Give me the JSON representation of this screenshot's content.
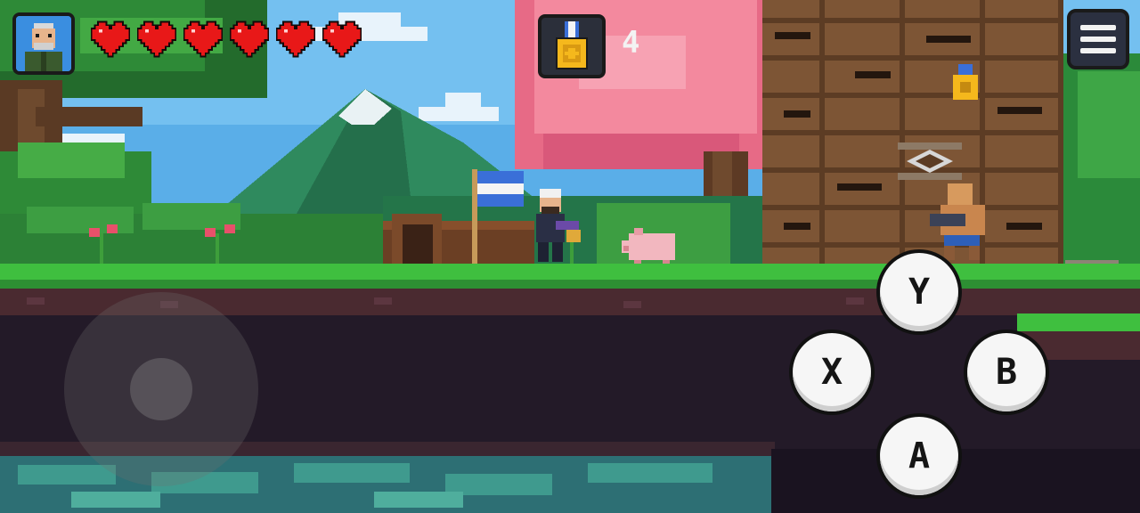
{
  "hud": {
    "health": {
      "current": 6,
      "max": 6,
      "heart_icon": "heart-icon"
    },
    "portrait_icon": "player-portrait-icon",
    "medal_icon": "gold-medal-icon",
    "medal_count": "4",
    "menu_icon": "hamburger-menu-icon"
  },
  "controls": {
    "joystick_icon": "virtual-joystick",
    "y_label": "Y",
    "x_label": "X",
    "b_label": "B",
    "a_label": "A"
  },
  "colors": {
    "heart_red": "#e81818",
    "grass_green": "#3fbf3f",
    "blossom_pink": "#ef6f8a",
    "medal_gold": "#f5b81c",
    "flag_blue": "#3a6fd8"
  }
}
